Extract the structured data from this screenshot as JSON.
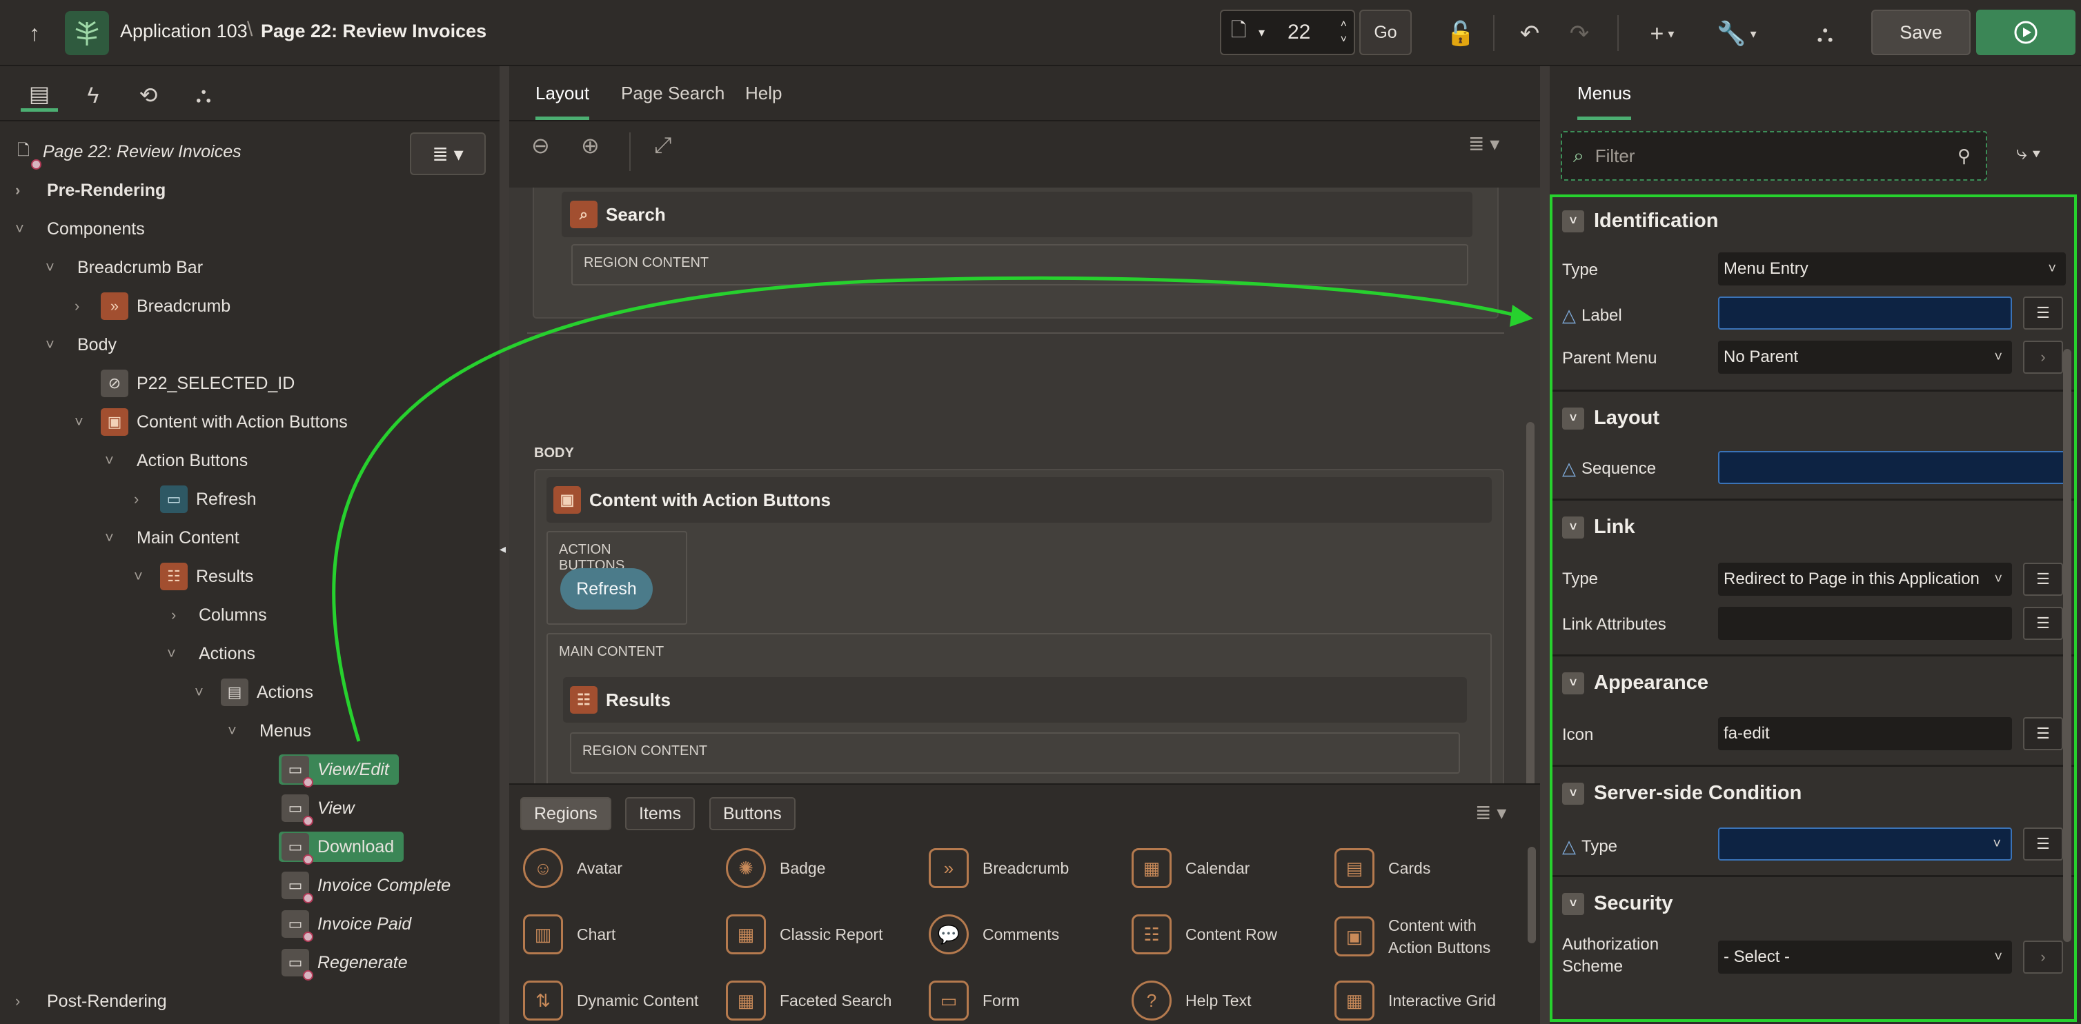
{
  "header": {
    "app_name": "Application 103",
    "page_name": "Page 22: Review Invoices",
    "page_number": "22",
    "go_label": "Go",
    "save_label": "Save"
  },
  "left_tree": {
    "root": "Page 22: Review Invoices",
    "pre_rendering": "Pre-Rendering",
    "components": "Components",
    "breadcrumb_bar": "Breadcrumb Bar",
    "breadcrumb": "Breadcrumb",
    "body": "Body",
    "p22": "P22_SELECTED_ID",
    "content_with_action_buttons": "Content with Action Buttons",
    "action_buttons": "Action Buttons",
    "refresh": "Refresh",
    "main_content": "Main Content",
    "results": "Results",
    "columns": "Columns",
    "actions_folder": "Actions",
    "actions": "Actions",
    "menus": "Menus",
    "menu_items": [
      "View/Edit",
      "View",
      "Download",
      "Invoice Complete",
      "Invoice Paid",
      "Regenerate"
    ],
    "post_rendering": "Post-Rendering"
  },
  "center": {
    "tabs": [
      "Layout",
      "Page Search",
      "Help"
    ],
    "search_region": "Search",
    "region_content": "REGION CONTENT",
    "body_label": "BODY",
    "cwab_region": "Content with Action Buttons",
    "action_buttons_label": "ACTION BUTTONS",
    "refresh_button": "Refresh",
    "main_content_label": "MAIN CONTENT",
    "results_region": "Results",
    "region_content_2": "REGION CONTENT"
  },
  "gallery": {
    "tabs": [
      "Regions",
      "Items",
      "Buttons"
    ],
    "items": [
      "Avatar",
      "Badge",
      "Breadcrumb",
      "Calendar",
      "Cards",
      "Chart",
      "Classic Report",
      "Comments",
      "Content Row",
      "Content with Action Buttons",
      "Dynamic Content",
      "Faceted Search",
      "Form",
      "Help Text",
      "Interactive Grid"
    ]
  },
  "right": {
    "tab": "Menus",
    "filter_placeholder": "Filter",
    "identification": "Identification",
    "type_label": "Type",
    "type_value": "Menu Entry",
    "label_label": "Label",
    "parent_menu_label": "Parent Menu",
    "parent_menu_value": "No Parent",
    "layout": "Layout",
    "sequence_label": "Sequence",
    "link": "Link",
    "link_type_label": "Type",
    "link_type_value": "Redirect to Page in this Application",
    "link_attributes_label": "Link Attributes",
    "appearance": "Appearance",
    "icon_label": "Icon",
    "icon_value": "fa-edit",
    "server_side_condition": "Server-side Condition",
    "ssc_type_label": "Type",
    "security": "Security",
    "auth_scheme_label_1": "Authorization",
    "auth_scheme_label_2": "Scheme",
    "auth_scheme_value": "- Select -"
  },
  "colors": {
    "accent_green": "#3b8656",
    "highlight_green": "#27d12e",
    "required_blue": "#3a73b8"
  }
}
